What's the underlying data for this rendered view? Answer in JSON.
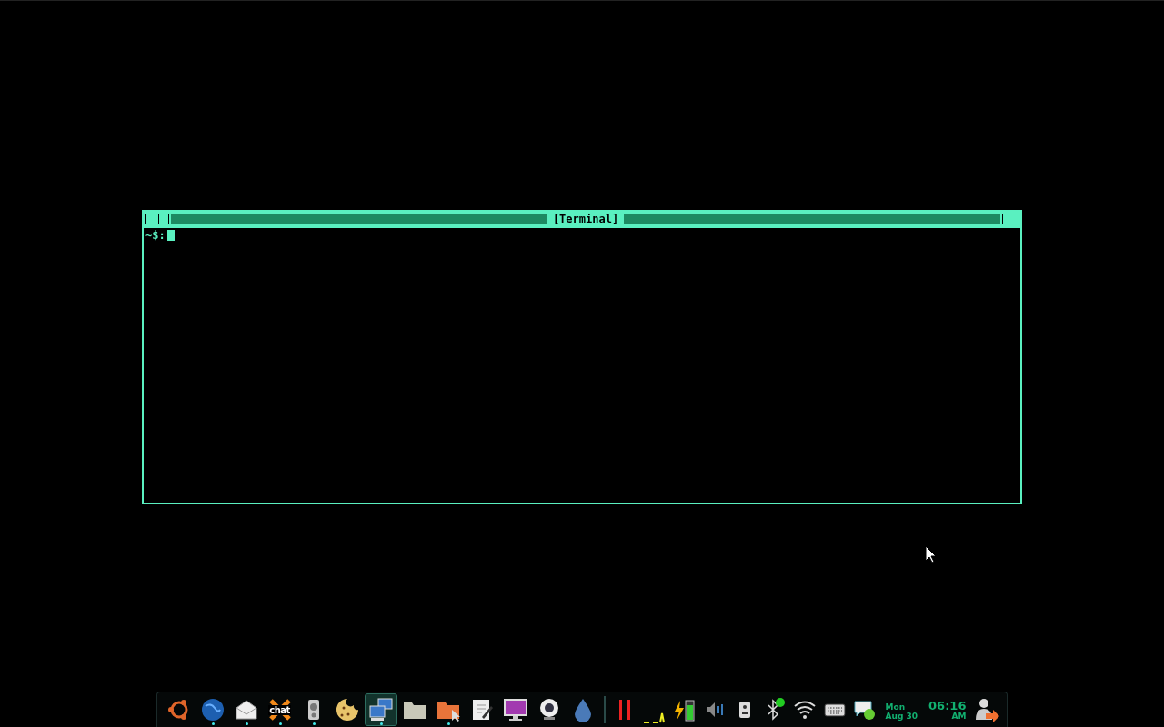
{
  "terminal": {
    "title": "[Terminal]",
    "prompt": "~$:"
  },
  "dock": {
    "launchers": [
      {
        "kind": "ubuntu",
        "running": false,
        "selected": false
      },
      {
        "kind": "globe",
        "running": true,
        "selected": false
      },
      {
        "kind": "mail",
        "running": true,
        "selected": false
      },
      {
        "kind": "chat",
        "label": "chat",
        "running": true,
        "selected": false
      },
      {
        "kind": "speaker",
        "running": true,
        "selected": false
      },
      {
        "kind": "cookie",
        "running": false,
        "selected": false
      },
      {
        "kind": "network",
        "running": true,
        "selected": true
      },
      {
        "kind": "folder",
        "running": false,
        "selected": false
      },
      {
        "kind": "folder-orange",
        "running": true,
        "selected": false
      },
      {
        "kind": "editor",
        "running": false,
        "selected": false
      },
      {
        "kind": "monitor",
        "running": false,
        "selected": false
      },
      {
        "kind": "webcam",
        "running": false,
        "selected": false
      },
      {
        "kind": "drop",
        "running": false,
        "selected": false
      }
    ],
    "tray": [
      {
        "kind": "meters"
      },
      {
        "kind": "graph"
      },
      {
        "kind": "battery"
      },
      {
        "kind": "volume"
      },
      {
        "kind": "speaker-box"
      },
      {
        "kind": "bluetooth"
      },
      {
        "kind": "wifi"
      },
      {
        "kind": "keyboard"
      },
      {
        "kind": "message"
      }
    ],
    "clock": {
      "day": "Mon",
      "date": "Aug 30",
      "time": "06:16",
      "ampm": "AM"
    }
  }
}
